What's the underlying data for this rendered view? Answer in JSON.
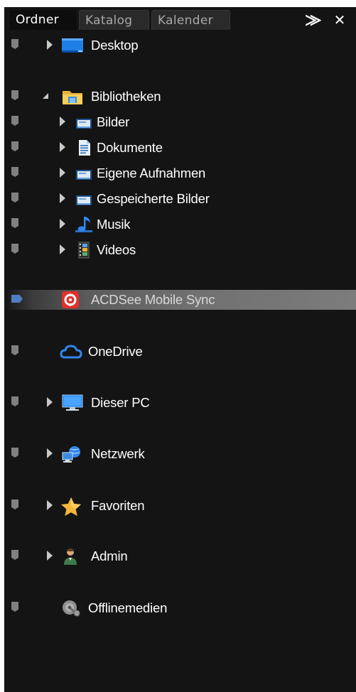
{
  "tabs": [
    {
      "label": "Ordner",
      "active": true
    },
    {
      "label": "Katalog",
      "active": false
    },
    {
      "label": "Kalender",
      "active": false
    }
  ],
  "tab_buttons": {
    "pin": "⨠",
    "close": "✕"
  },
  "colors": {
    "background": "#141414",
    "text": "#ffffff",
    "selection_marker": "#4f7ec3",
    "marker": "#808080"
  },
  "tree": {
    "desktop": {
      "label": "Desktop",
      "icon": "desktop-icon"
    },
    "libraries": {
      "label": "Bibliotheken",
      "icon": "library-folder-icon"
    },
    "pictures": {
      "label": "Bilder",
      "icon": "pictures-library-icon"
    },
    "documents": {
      "label": "Dokumente",
      "icon": "documents-library-icon"
    },
    "own_recordings": {
      "label": "Eigene Aufnahmen",
      "icon": "pictures-library-icon"
    },
    "saved_pictures": {
      "label": "Gespeicherte Bilder",
      "icon": "pictures-library-icon"
    },
    "music": {
      "label": "Musik",
      "icon": "music-library-icon"
    },
    "videos": {
      "label": "Videos",
      "icon": "videos-library-icon"
    },
    "acdsee_sync": {
      "label": "ACDSee Mobile Sync",
      "icon": "acdsee-sync-icon",
      "selected": true
    },
    "onedrive": {
      "label": "OneDrive",
      "icon": "onedrive-cloud-icon"
    },
    "this_pc": {
      "label": "Dieser PC",
      "icon": "computer-icon"
    },
    "network": {
      "label": "Netzwerk",
      "icon": "network-icon"
    },
    "favorites": {
      "label": "Favoriten",
      "icon": "star-icon"
    },
    "admin": {
      "label": "Admin",
      "icon": "user-icon"
    },
    "offline_media": {
      "label": "Offlinemedien",
      "icon": "offline-media-icon"
    }
  }
}
